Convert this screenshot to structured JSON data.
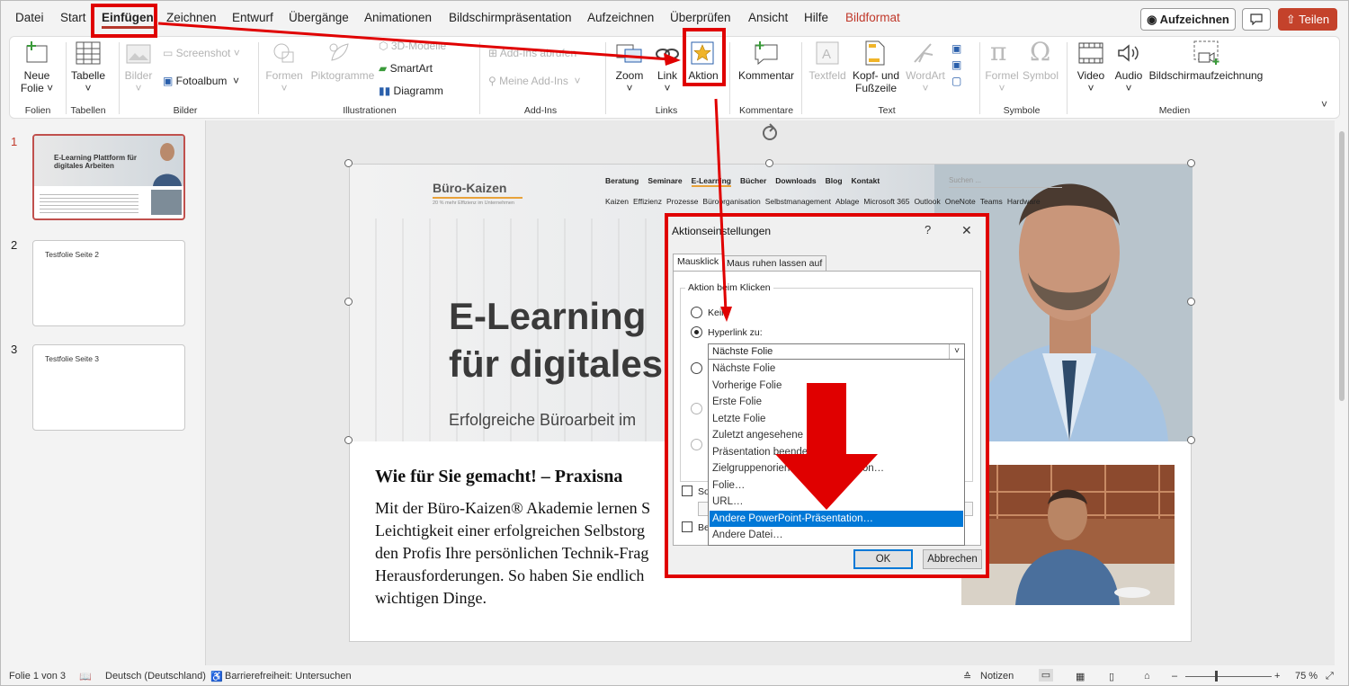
{
  "menu": {
    "items": [
      "Datei",
      "Start",
      "Einfügen",
      "Zeichnen",
      "Entwurf",
      "Übergänge",
      "Animationen",
      "Bildschirmpräsentation",
      "Aufzeichnen",
      "Überprüfen",
      "Ansicht",
      "Hilfe",
      "Bildformat"
    ],
    "record_button": "Aufzeichnen",
    "share_button": "Teilen"
  },
  "ribbon": {
    "groups": {
      "folien": "Folien",
      "tabellen": "Tabellen",
      "bilder": "Bilder",
      "illustrationen": "Illustrationen",
      "addins": "Add-Ins",
      "links": "Links",
      "kommentare": "Kommentare",
      "text": "Text",
      "symbole": "Symbole",
      "medien": "Medien"
    },
    "buttons": {
      "neue_folie_1": "Neue",
      "neue_folie_2": "Folie",
      "tabelle": "Tabelle",
      "bilder": "Bilder",
      "screenshot": "Screenshot",
      "fotoalbum": "Fotoalbum",
      "formen": "Formen",
      "piktogramme": "Piktogramme",
      "modelle_3d": "3D-Modelle",
      "smartart": "SmartArt",
      "diagramm": "Diagramm",
      "addins_abrufen": "Add-Ins abrufen",
      "meine_addins": "Meine Add-Ins",
      "zoom": "Zoom",
      "link": "Link",
      "aktion": "Aktion",
      "kommentar": "Kommentar",
      "textfeld": "Textfeld",
      "kopf_fuss_1": "Kopf- und",
      "kopf_fuss_2": "Fußzeile",
      "wordart": "WordArt",
      "formel": "Formel",
      "symbol": "Symbol",
      "video": "Video",
      "audio": "Audio",
      "bildschirmaufzeichnung": "Bildschirmaufzeichnung"
    }
  },
  "thumbnails": [
    {
      "number": "1",
      "title": "E-Learning Plattform für digitales Arbeiten"
    },
    {
      "number": "2",
      "title": "Testfolie Seite 2"
    },
    {
      "number": "3",
      "title": "Testfolie Seite 3"
    }
  ],
  "slide": {
    "logo": "Büro-Kaizen",
    "logo_sub": "20 % mehr Effizienz im Unternehmen",
    "nav_top": [
      "Beratung",
      "Seminare",
      "E-Learning",
      "Bücher",
      "Downloads",
      "Blog",
      "Kontakt"
    ],
    "nav_bottom": [
      "Kaizen",
      "Effizienz",
      "Prozesse",
      "Büroorganisation",
      "Selbstmanagement",
      "Ablage",
      "Microsoft 365",
      "Outlook",
      "OneNote",
      "Teams",
      "Hardware"
    ],
    "search_placeholder": "Suchen ...",
    "headline_1": "E-Learning",
    "headline_2": "für digitales",
    "subline": "Erfolgreiche Büroarbeit im",
    "body_heading": "Wie für Sie gemacht! – Praxisna",
    "body_lines": [
      "Mit der Büro-Kaizen® Akademie lernen S",
      "Leichtigkeit einer erfolgreichen Selbstorg",
      "den Profis Ihre persönlichen Technik-Frag",
      "Herausforderungen. So haben Sie endlich",
      "wichtigen Dinge."
    ]
  },
  "dialog": {
    "title": "Aktionseinstellungen",
    "help": "?",
    "close": "✕",
    "tabs": [
      "Mausklick",
      "Maus ruhen lassen auf"
    ],
    "fieldset_label": "Aktion beim Klicken",
    "radio_none": "Kein",
    "radio_hyperlink": "Hyperlink zu:",
    "combo_value": "Nächste Folie",
    "dropdown_options": [
      "Nächste Folie",
      "Vorherige Folie",
      "Erste Folie",
      "Letzte Folie",
      "Zuletzt angesehene",
      "Präsentation beende",
      "Zielgruppenorientierte Präsentation…",
      "Folie…",
      "URL…",
      "Andere PowerPoint-Präsentation…",
      "Andere Datei…"
    ],
    "selected_option_index": 9,
    "check_1_label": "So",
    "check_2_label": "Be",
    "ok": "OK",
    "cancel": "Abbrechen"
  },
  "status": {
    "slide_info": "Folie 1 von 3",
    "language": "Deutsch (Deutschland)",
    "accessibility": "Barrierefreiheit: Untersuchen",
    "notes": "Notizen",
    "zoom": "75 %"
  },
  "colors": {
    "accent_red": "#e00000",
    "brand_orange": "#e8a23a",
    "share": "#c4422b",
    "selection_blue": "#0078d7"
  }
}
